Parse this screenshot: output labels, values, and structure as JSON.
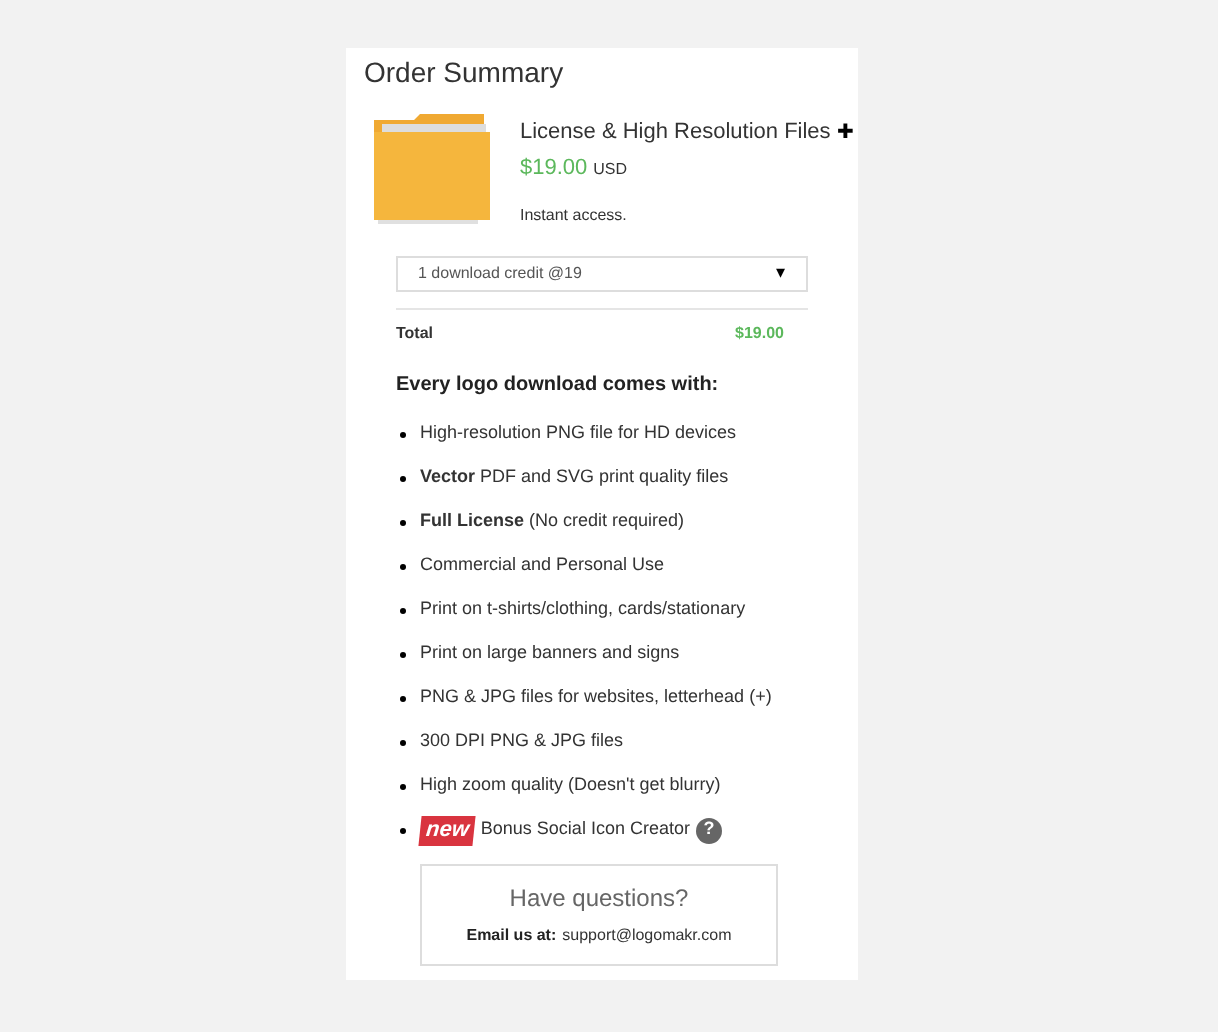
{
  "title": "Order Summary",
  "product": {
    "name": "License & High Resolution Files",
    "plus": "✚",
    "price": "$19.00",
    "currency": "USD",
    "note": "Instant access."
  },
  "select": {
    "value": "1 download credit @19",
    "caret": "▾"
  },
  "total": {
    "label": "Total",
    "amount": "$19.00"
  },
  "features_heading": "Every logo download comes with:",
  "features": [
    {
      "kind": "text",
      "text": "High-resolution PNG file for HD devices"
    },
    {
      "kind": "text",
      "text": "**Vector** PDF and SVG print quality files"
    },
    {
      "kind": "text",
      "text": "**Full License** (No credit required)"
    },
    {
      "kind": "text",
      "text": "Commercial and Personal Use"
    },
    {
      "kind": "text",
      "text": "Print on t-shirts/clothing, cards/stationary"
    },
    {
      "kind": "text",
      "text": "Print on large banners and signs"
    },
    {
      "kind": "text",
      "text": "PNG & JPG files for websites, letterhead (+)"
    },
    {
      "kind": "text",
      "text": "300 DPI PNG & JPG files"
    },
    {
      "kind": "text",
      "text": "High zoom quality (Doesn't get blurry)"
    },
    {
      "kind": "badge",
      "badge": "new",
      "text": "Bonus Social Icon Creator",
      "help": "?"
    }
  ],
  "contact": {
    "heading": "Have questions?",
    "label": "Email us at:",
    "email": "support@logomakr.com"
  }
}
